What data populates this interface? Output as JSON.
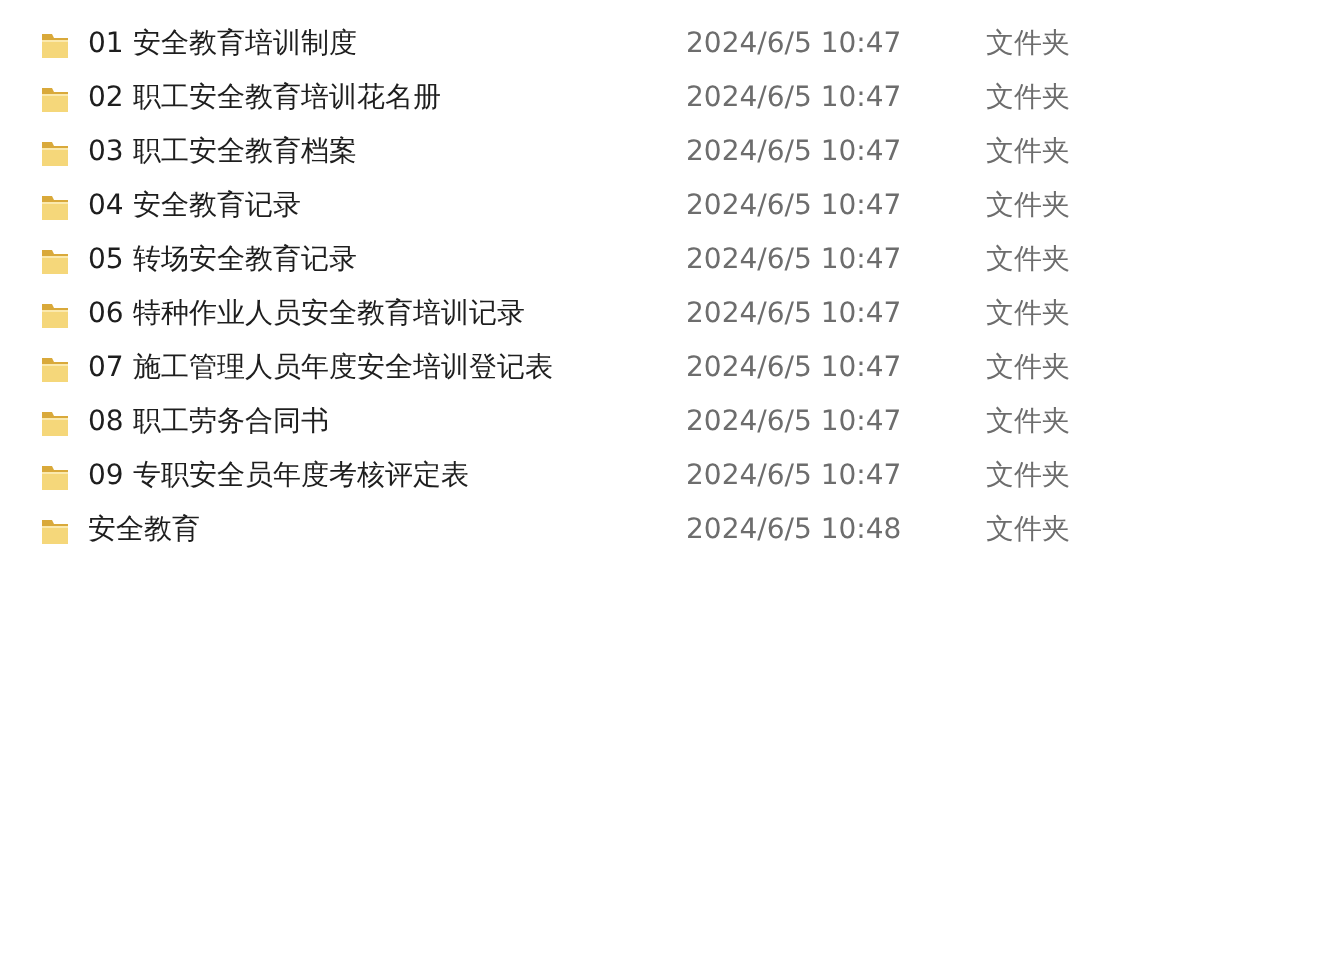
{
  "files": [
    {
      "name": "01 安全教育培训制度",
      "modified": "2024/6/5 10:47",
      "type": "文件夹"
    },
    {
      "name": "02 职工安全教育培训花名册",
      "modified": "2024/6/5 10:47",
      "type": "文件夹"
    },
    {
      "name": "03 职工安全教育档案",
      "modified": "2024/6/5 10:47",
      "type": "文件夹"
    },
    {
      "name": "04 安全教育记录",
      "modified": "2024/6/5 10:47",
      "type": "文件夹"
    },
    {
      "name": "05 转场安全教育记录",
      "modified": "2024/6/5 10:47",
      "type": "文件夹"
    },
    {
      "name": "06 特种作业人员安全教育培训记录",
      "modified": "2024/6/5 10:47",
      "type": "文件夹"
    },
    {
      "name": "07 施工管理人员年度安全培训登记表",
      "modified": "2024/6/5 10:47",
      "type": "文件夹"
    },
    {
      "name": "08 职工劳务合同书",
      "modified": "2024/6/5 10:47",
      "type": "文件夹"
    },
    {
      "name": "09 专职安全员年度考核评定表",
      "modified": "2024/6/5 10:47",
      "type": "文件夹"
    },
    {
      "name": "安全教育",
      "modified": "2024/6/5 10:48",
      "type": "文件夹"
    }
  ]
}
